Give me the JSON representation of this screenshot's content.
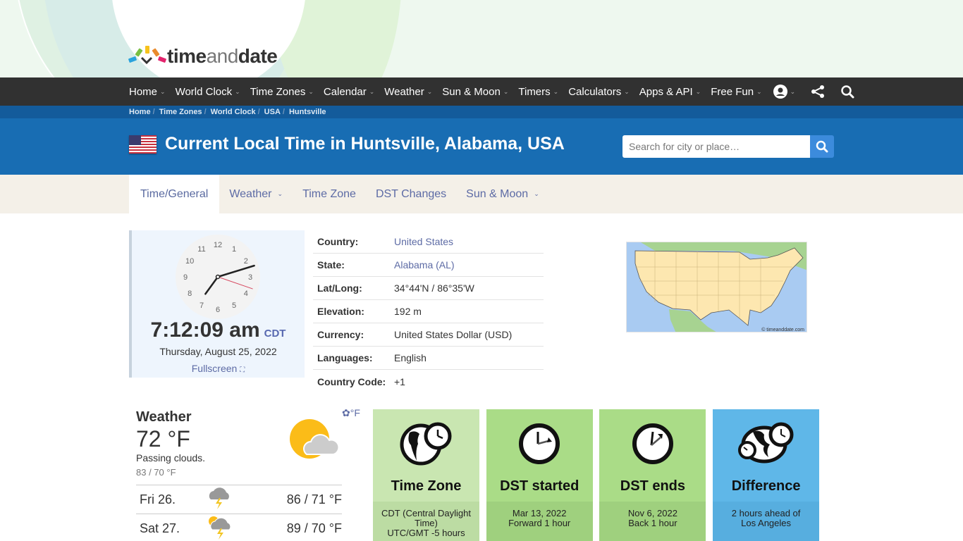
{
  "brand": {
    "name_part1": "time",
    "name_part2": "and",
    "name_part3": "date",
    "logo_colors": [
      "#2aa3dd",
      "#79bf43",
      "#f7c21c",
      "#e98a2c",
      "#e3246d"
    ]
  },
  "nav": {
    "items": [
      {
        "label": "Home"
      },
      {
        "label": "World Clock"
      },
      {
        "label": "Time Zones"
      },
      {
        "label": "Calendar"
      },
      {
        "label": "Weather"
      },
      {
        "label": "Sun & Moon"
      },
      {
        "label": "Timers"
      },
      {
        "label": "Calculators"
      },
      {
        "label": "Apps & API"
      },
      {
        "label": "Free Fun"
      }
    ],
    "account_icon": "user-circle-icon",
    "share_icon": "share-icon",
    "search_icon": "search-icon"
  },
  "breadcrumb": [
    "Home",
    "Time Zones",
    "World Clock",
    "USA",
    "Huntsville"
  ],
  "title": {
    "text": "Current Local Time in Huntsville, Alabama, USA",
    "flag": "us-flag-icon"
  },
  "search": {
    "placeholder": "Search for city or place…"
  },
  "tabs": [
    {
      "label": "Time/General",
      "active": true,
      "dropdown": false
    },
    {
      "label": "Weather",
      "active": false,
      "dropdown": true
    },
    {
      "label": "Time Zone",
      "active": false,
      "dropdown": false
    },
    {
      "label": "DST Changes",
      "active": false,
      "dropdown": false
    },
    {
      "label": "Sun & Moon",
      "active": false,
      "dropdown": true
    }
  ],
  "clock": {
    "time": "7:12:09 am",
    "tz": "CDT",
    "date": "Thursday, August 25, 2022",
    "fullscreen_label": "Fullscreen",
    "hours": 7,
    "minutes": 12,
    "seconds": 9,
    "numerals": [
      "12",
      "1",
      "2",
      "3",
      "4",
      "5",
      "6",
      "7",
      "8",
      "9",
      "10",
      "11"
    ]
  },
  "info": [
    {
      "key": "Country:",
      "value": "United States",
      "link": true
    },
    {
      "key": "State:",
      "value": "Alabama (AL)",
      "link": true
    },
    {
      "key": "Lat/Long:",
      "value": "34°44'N / 86°35'W",
      "link": false
    },
    {
      "key": "Elevation:",
      "value": "192 m",
      "link": false
    },
    {
      "key": "Currency:",
      "value": "United States Dollar (USD)",
      "link": false
    },
    {
      "key": "Languages:",
      "value": "English",
      "link": false
    },
    {
      "key": "Country Code:",
      "value": "+1",
      "link": false
    }
  ],
  "map": {
    "credit": "© timeanddate.com"
  },
  "weather": {
    "heading": "Weather",
    "unit_label": "°F",
    "temp": "72 °F",
    "description": "Passing clouds.",
    "high_low": "83 / 70 °F",
    "forecast": [
      {
        "day": "Fri 26.",
        "icon": "thunderstorm-icon",
        "temps": "86 / 71 °F"
      },
      {
        "day": "Sat 27.",
        "icon": "partly-sunny-thunderstorm-icon",
        "temps": "89 / 70 °F"
      }
    ]
  },
  "cards": [
    {
      "title": "Time Zone",
      "line1": "CDT (Central Daylight Time)",
      "line2": "UTC/GMT -5 hours",
      "top_color": "#c9e6b1",
      "bottom_color": "#bcdca3"
    },
    {
      "title": "DST started",
      "line1": "Mar 13, 2022",
      "line2": "Forward 1 hour",
      "top_color": "#aadc87",
      "bottom_color": "#9fd07e"
    },
    {
      "title": "DST ends",
      "line1": "Nov 6, 2022",
      "line2": "Back 1 hour",
      "top_color": "#aadc87",
      "bottom_color": "#9fd07e"
    },
    {
      "title": "Difference",
      "line1": "2 hours ahead of",
      "line2": "Los Angeles",
      "top_color": "#5fb7e8",
      "bottom_color": "#57aedf"
    }
  ]
}
